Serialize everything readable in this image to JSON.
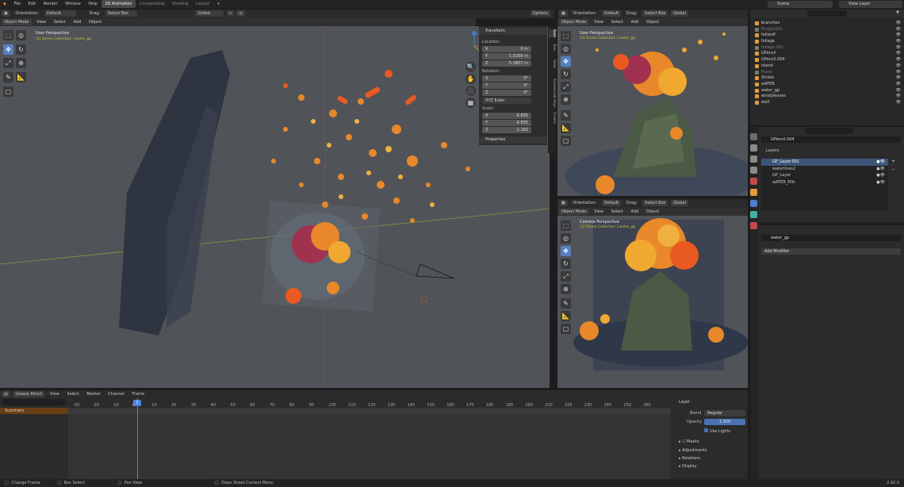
{
  "menubar": {
    "items": [
      "File",
      "Edit",
      "Render",
      "Window",
      "Help"
    ],
    "workspaces": [
      "2D Animation",
      "Compositing",
      "Shading",
      "Layout"
    ],
    "active": "2D Animation",
    "scene": "Scene",
    "view_layer": "View Layer"
  },
  "main_header": {
    "mode": "Orientation:",
    "default": "Default",
    "drag": "Drag:",
    "select": "Select Box",
    "global": "Global",
    "options": "Options"
  },
  "main_menu": {
    "mode": "Object Mode",
    "items": [
      "View",
      "Select",
      "Add",
      "Object"
    ]
  },
  "main_vp": {
    "title": "User Perspective",
    "subtitle": "(1) Scene Collection | water_gp"
  },
  "npanel": {
    "tabs": [
      "Item",
      "Tool",
      "View",
      "Screencast Keys",
      "Create"
    ],
    "transform": "Transform",
    "location": "Location:",
    "loc": [
      {
        "axis": "X",
        "val": "0 m"
      },
      {
        "axis": "Y",
        "val": "1.0206 m"
      },
      {
        "axis": "Z",
        "val": "-5.3807 m"
      }
    ],
    "rotation": "Rotation:",
    "rot": [
      {
        "axis": "X",
        "val": "0°"
      },
      {
        "axis": "Y",
        "val": "0°"
      },
      {
        "axis": "Z",
        "val": "0°"
      }
    ],
    "euler": "XYZ Euler",
    "scale": "Scale:",
    "scl": [
      {
        "axis": "X",
        "val": "6.835"
      },
      {
        "axis": "Y",
        "val": "6.835"
      },
      {
        "axis": "Z",
        "val": "2.182"
      }
    ],
    "properties": "Properties"
  },
  "tr_header": {
    "mode": "Object Mode",
    "items": [
      "View",
      "Select",
      "Add",
      "Object"
    ],
    "orientation": "Orientation:",
    "default": "Default",
    "drag": "Drag:",
    "select": "Select Box",
    "global": "Global"
  },
  "tr_vp": {
    "title": "User Perspective",
    "subtitle": "(1) Scene Collection | water_gp"
  },
  "br_header": {
    "mode": "Object Mode",
    "items": [
      "View",
      "Select",
      "Add",
      "Object"
    ],
    "orientation": "Orientation:",
    "default": "Default",
    "drag": "Drag:",
    "select": "Select Box",
    "global": "Global"
  },
  "br_vp": {
    "title": "Camera Perspective",
    "subtitle": "(1) Scene Collection | water_gp"
  },
  "outliner": {
    "items": [
      {
        "name": "branches",
        "dim": false
      },
      {
        "name": "Empty.001",
        "dim": true
      },
      {
        "name": "fallwolf",
        "dim": false
      },
      {
        "name": "foliage",
        "dim": false
      },
      {
        "name": "foliage.001",
        "dim": true
      },
      {
        "name": "GPencil",
        "dim": false
      },
      {
        "name": "GPencil.004",
        "dim": false
      },
      {
        "name": "island",
        "dim": false
      },
      {
        "name": "Plane",
        "dim": true
      },
      {
        "name": "Stroke",
        "dim": false
      },
      {
        "name": "wATER",
        "dim": false
      },
      {
        "name": "water_gp",
        "dim": false
      },
      {
        "name": "windyleaves",
        "dim": false
      },
      {
        "name": "wolf",
        "dim": false
      }
    ]
  },
  "props_data": {
    "object": "GPencil.004",
    "layers_label": "Layers",
    "layers": [
      {
        "name": "GP_Layer.001",
        "active": true
      },
      {
        "name": "waterlines2",
        "active": false
      },
      {
        "name": "GP_Layer",
        "active": false
      },
      {
        "name": "wATER_Fills",
        "active": false
      }
    ]
  },
  "modifiers": {
    "object": "water_gp",
    "add": "Add Modifier"
  },
  "timeline": {
    "editor": "Grease Pencil",
    "menu": [
      "View",
      "Select",
      "Marker",
      "Channel",
      "Frame"
    ],
    "summary": "Summary",
    "current_frame": "1",
    "ticks": [
      "-30",
      "-20",
      "-10",
      "1",
      "10",
      "20",
      "30",
      "40",
      "50",
      "60",
      "70",
      "80",
      "90",
      "100",
      "110",
      "120",
      "130",
      "140",
      "150",
      "160",
      "170",
      "180",
      "190",
      "200",
      "210",
      "220",
      "230",
      "240",
      "250",
      "260"
    ]
  },
  "layer_panel": {
    "title": "Layer",
    "blend_label": "Blend",
    "blend": "Regular",
    "opacity_label": "Opacity",
    "opacity": "1.000",
    "use_lights": "Use Lights",
    "sections": [
      "Masks",
      "Adjustments",
      "Relations",
      "Display"
    ]
  },
  "status": {
    "items": [
      "Change Frame",
      "Box Select",
      "Pan View",
      "Dope Sheet Context Menu"
    ],
    "version": "2.92.0"
  },
  "colors": {
    "accent": "#4772b3",
    "viewport": "#505459",
    "header": "#2b2b2b",
    "orange": "#e8882a"
  }
}
